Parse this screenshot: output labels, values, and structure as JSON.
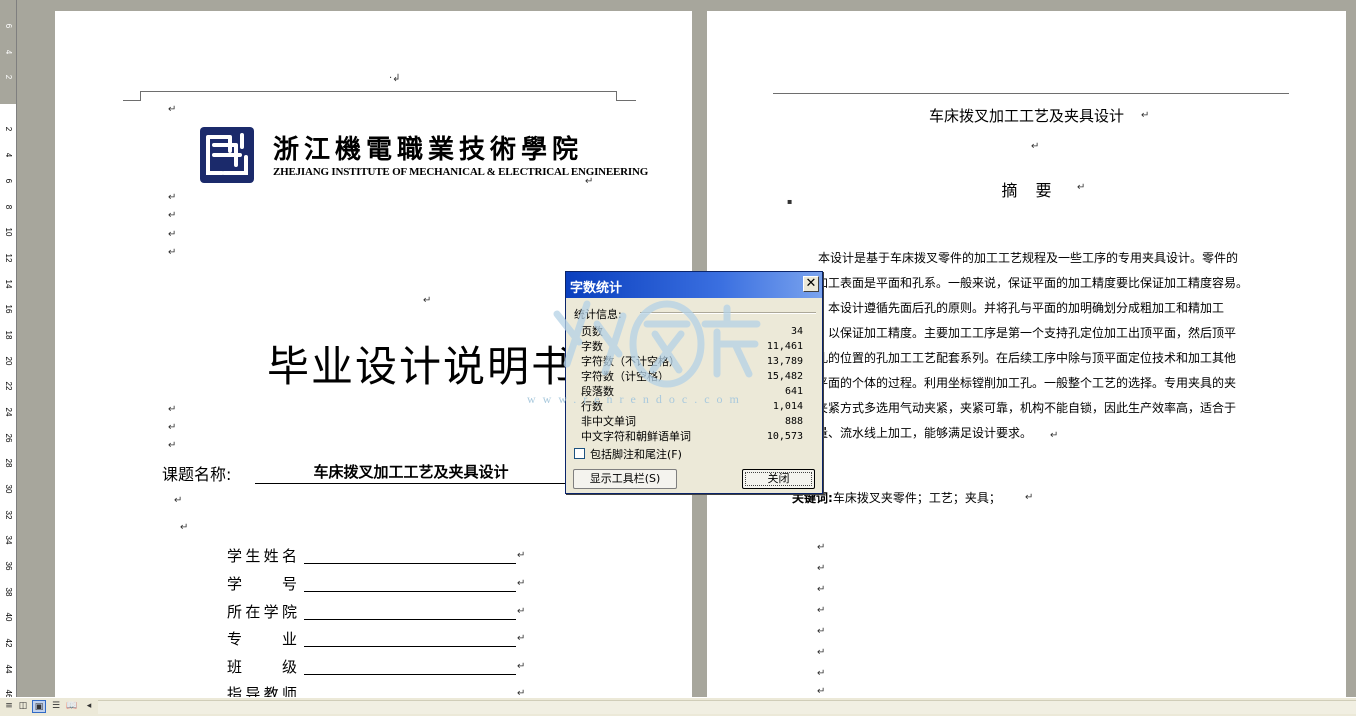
{
  "ruler": {
    "labels": [
      "6",
      "4",
      "2",
      "2",
      "4",
      "6",
      "8",
      "10",
      "12",
      "14",
      "16",
      "18",
      "20",
      "22",
      "24",
      "26",
      "28",
      "30",
      "32",
      "34",
      "36",
      "38",
      "40",
      "42",
      "44",
      "46"
    ]
  },
  "page1": {
    "return_mark": "↵",
    "small_mark": "·↲",
    "logo": {
      "cn_name": "浙江機電職業技術學院",
      "en_name": "ZHEJIANG INSTITUTE OF MECHANICAL & ELECTRICAL ENGINEERING"
    },
    "doc_title": "毕业设计说明书",
    "topic_label": "课题名称:",
    "topic_value": "车床拨叉加工工艺及夹具设计",
    "form_fields": [
      {
        "label": "学生姓名"
      },
      {
        "label": "学号"
      },
      {
        "label": "所在学院"
      },
      {
        "label": "专业"
      },
      {
        "label": "班级"
      },
      {
        "label": "指导教师"
      }
    ]
  },
  "page2": {
    "title": "车床拨叉加工工艺及夹具设计",
    "abstract_heading": "摘要",
    "bullet": "▪",
    "abstract_lines": [
      "本设计是基于车床拨叉零件的加工工艺规程及一些工序的专用夹具设计。零件的",
      "主要加工表面是平面和孔系。一般来说，保证平面的加工精度要比保证加工精度容易。",
      "因此，本设计遵循先面后孔的原则。并将孔与平面的加明确划分成粗加工和精加工",
      "阶段，以保证加工精度。主要加工工序是第一个支持孔定位加工出顶平面，然后顶平",
      "面和孔的位置的孔加工工艺配套系列。在后续工序中除与顶平面定位技术和加工其他",
      "的表平面的个体的过程。利用坐标镗削加工孔。一般整个工艺的选择。专用夹具的夹",
      "具的夹紧方式多选用气动夹紧，夹紧可靠，机构不能自锁，因此生产效率高，适合于",
      "大批量、流水线上加工，能够满足设计要求。"
    ],
    "keywords_label": "关键词:",
    "keywords_value": "车床拨叉夹零件；工艺；夹具；"
  },
  "watermark": {
    "text": "www.renrendoc.com"
  },
  "dialog": {
    "title": "字数统计",
    "close_glyph": "✕",
    "section_label": "统计信息:",
    "stats": [
      {
        "label": "页数",
        "value": "34"
      },
      {
        "label": "字数",
        "value": "11,461"
      },
      {
        "label": "字符数（不计空格）",
        "value": "13,789"
      },
      {
        "label": "字符数（计空格）",
        "value": "15,482"
      },
      {
        "label": "段落数",
        "value": "641"
      },
      {
        "label": "行数",
        "value": "1,014"
      },
      {
        "label": "非中文单词",
        "value": "888"
      },
      {
        "label": "中文字符和朝鲜语单词",
        "value": "10,573"
      }
    ],
    "checkbox_label": "包括脚注和尾注(F)",
    "toolbar_button": "显示工具栏(S)",
    "close_button": "关闭"
  },
  "statusbar": {
    "left_arrow": "◂"
  },
  "colors": {
    "titlebar": "#0a3fbe",
    "workspace": "#a7a69c",
    "dialog_bg": "#ece9d8"
  }
}
